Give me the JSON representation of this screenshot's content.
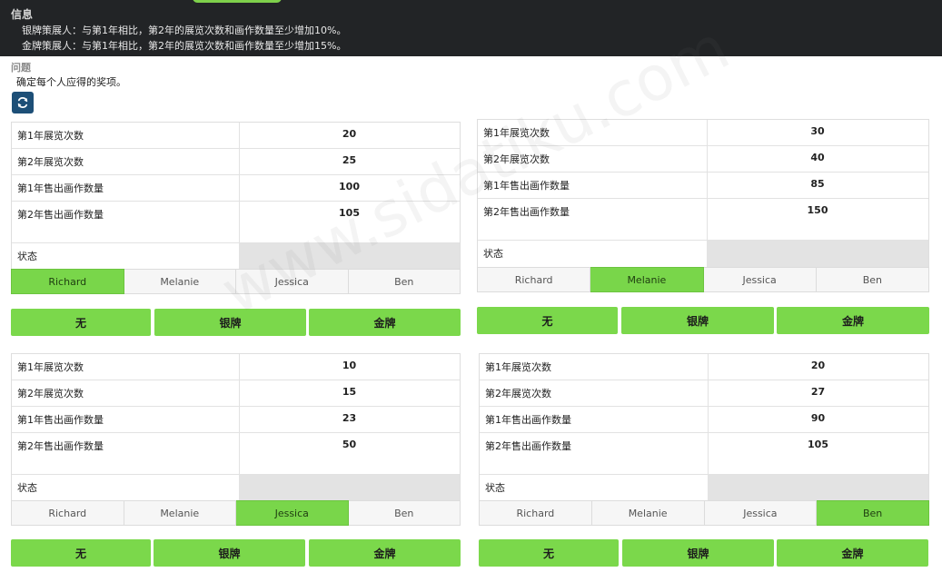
{
  "info": {
    "title": "信息",
    "lines": [
      "银牌策展人：与第1年相比，第2年的展览次数和画作数量至少增加10%。",
      "金牌策展人：与第1年相比，第2年的展览次数和画作数量至少增加15%。"
    ]
  },
  "question": {
    "title": "问题",
    "text": "确定每个人应得的奖项。",
    "reset_icon": "refresh-icon"
  },
  "row_labels": [
    "第1年展览次数",
    "第2年展览次数",
    "第1年售出画作数量",
    "第2年售出画作数量"
  ],
  "status_label": "状态",
  "persons": [
    "Richard",
    "Melanie",
    "Jessica",
    "Ben"
  ],
  "awards": [
    "无",
    "银牌",
    "金牌"
  ],
  "accent_color": "#7bd84b",
  "panels": [
    {
      "values": [
        "20",
        "25",
        "100",
        "105"
      ],
      "selected_person": "Richard"
    },
    {
      "values": [
        "30",
        "40",
        "85",
        "150"
      ],
      "selected_person": "Melanie"
    },
    {
      "values": [
        "10",
        "15",
        "23",
        "50"
      ],
      "selected_person": "Jessica"
    },
    {
      "values": [
        "20",
        "27",
        "90",
        "105"
      ],
      "selected_person": "Ben"
    }
  ],
  "watermark": "www.sidatiku.com"
}
